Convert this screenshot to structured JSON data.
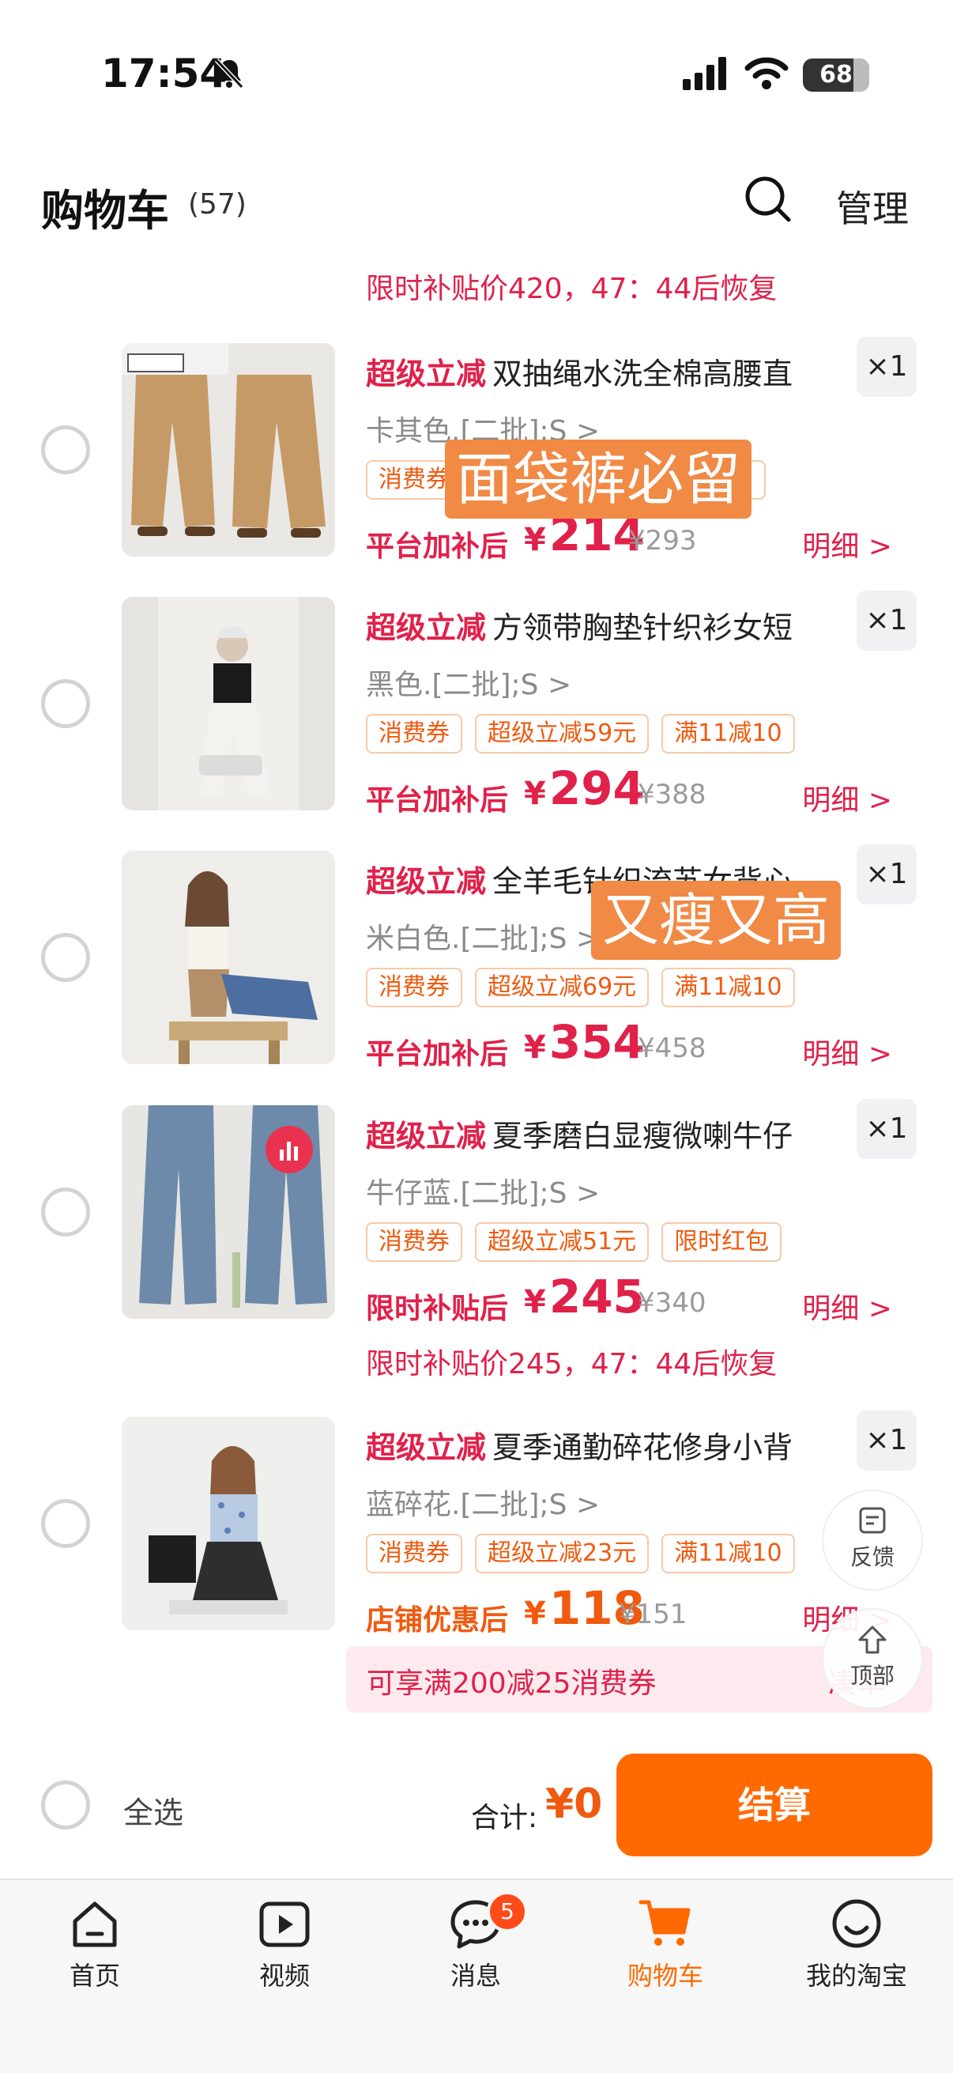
{
  "status_bar": {
    "time": "17:54",
    "battery": "68"
  },
  "header": {
    "title": "购物车",
    "count": "(57)",
    "manage": "管理"
  },
  "colors": {
    "accent": "#ff6a00",
    "price_red": "#e0214a"
  },
  "items": [
    {
      "promo_top": "限时补贴价420，47：44后恢复",
      "tag": "超级立减",
      "name": "双抽绳水洗全棉高腰直",
      "spec": "卡其色.[二批];S >",
      "qty": "×1",
      "chips": [
        "消费券",
        "0"
      ],
      "price_label": "平台加补后",
      "price": "214",
      "original": "¥293",
      "detail": "明细 >"
    },
    {
      "tag": "超级立减",
      "name": "方领带胸垫针织衫女短",
      "spec": "黑色.[二批];S >",
      "qty": "×1",
      "chips": [
        "消费券",
        "超级立减59元",
        "满11减10"
      ],
      "price_label": "平台加补后",
      "price": "294",
      "original": "¥388",
      "detail": "明细 >"
    },
    {
      "tag": "超级立减",
      "name": "全羊毛针织流苏女背心",
      "spec": "米白色.[二批];S >",
      "qty": "×1",
      "chips": [
        "消费券",
        "超级立减69元",
        "满11减10"
      ],
      "price_label": "平台加补后",
      "price": "354",
      "original": "¥458",
      "detail": "明细 >"
    },
    {
      "tag": "超级立减",
      "name": "夏季磨白显瘦微喇牛仔",
      "spec": "牛仔蓝.[二批];S >",
      "qty": "×1",
      "chips": [
        "消费券",
        "超级立减51元",
        "限时红包"
      ],
      "price_label": "限时补贴后",
      "price": "245",
      "original": "¥340",
      "detail": "明细 >",
      "promo_bottom": "限时补贴价245，47：44后恢复"
    },
    {
      "tag": "超级立减",
      "name": "夏季通勤碎花修身小背",
      "spec": "蓝碎花.[二批];S >",
      "qty": "×1",
      "chips": [
        "消费券",
        "超级立减23元",
        "满11减10"
      ],
      "price_label": "店铺优惠后",
      "price": "118",
      "original": "¥151",
      "detail": "明细 >"
    }
  ],
  "overlays": {
    "first": "面袋裤必留",
    "second": "又瘦又高"
  },
  "currency": "¥",
  "floating": {
    "feedback": "反馈",
    "top": "顶部"
  },
  "coupon_bar": {
    "text": "可享满200减25消费券",
    "link": "凑单"
  },
  "checkout": {
    "select_all": "全选",
    "total_label": "合计:",
    "total": "¥0",
    "button": "结算"
  },
  "tabbar": {
    "tabs": [
      {
        "label": "首页",
        "icon": "home-icon"
      },
      {
        "label": "视频",
        "icon": "video-icon"
      },
      {
        "label": "消息",
        "icon": "message-icon",
        "badge": "5"
      },
      {
        "label": "购物车",
        "icon": "cart-icon",
        "active": true
      },
      {
        "label": "我的淘宝",
        "icon": "profile-icon"
      }
    ]
  }
}
